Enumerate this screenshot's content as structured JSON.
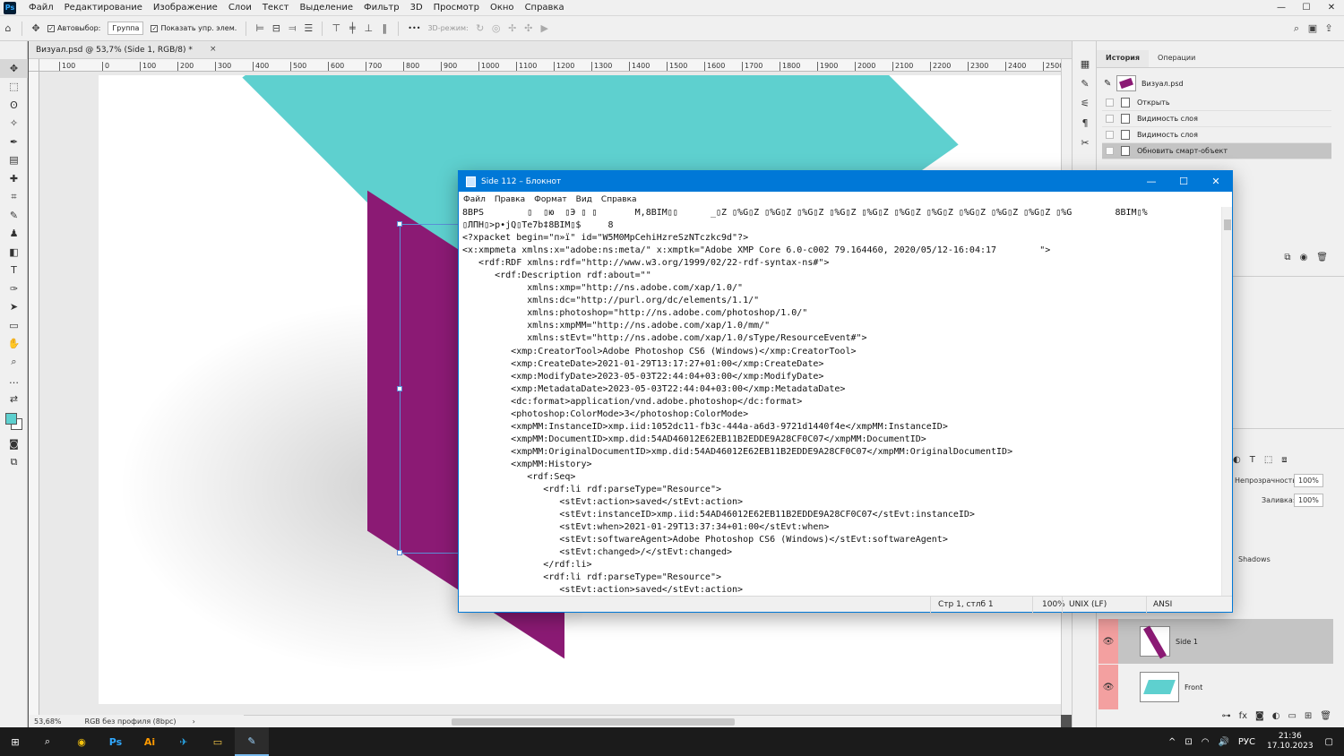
{
  "ps": {
    "logo": "Ps",
    "menu": [
      "Файл",
      "Редактирование",
      "Изображение",
      "Слои",
      "Текст",
      "Выделение",
      "Фильтр",
      "3D",
      "Просмотр",
      "Окно",
      "Справка"
    ],
    "window_buttons": [
      "—",
      "☐",
      "✕"
    ],
    "options": {
      "autoselect_label": "Автовыбор:",
      "group_value": "Группа",
      "show_controls_label": "Показать упр. элем.",
      "mode_3d_label": "3D-режим:",
      "more": "•••"
    },
    "doc_tab": {
      "label": "Визуал.psd @ 53,7% (Side 1, RGB/8) *",
      "close": "×"
    },
    "ruler_ticks": [
      "100",
      "0",
      "100",
      "200",
      "300",
      "400",
      "500",
      "600",
      "700",
      "800",
      "900",
      "1000",
      "1100",
      "1200",
      "1300",
      "1400",
      "1500",
      "1600",
      "1700",
      "1800",
      "1900",
      "2000",
      "2100",
      "2200",
      "2300",
      "2400",
      "2500"
    ],
    "status": {
      "zoom": "53,68%",
      "profile": "RGB без профиля (8bpc)",
      "arrow": "›"
    },
    "history": {
      "tabs": [
        "История",
        "Операции"
      ],
      "snapshot": "Визуал.psd",
      "rows": [
        "Открыть",
        "Видимость слоя",
        "Видимость слоя",
        "Обновить смарт-объект"
      ]
    },
    "layers": {
      "opacity_label": "Непрозрачность:",
      "opacity_value": "100%",
      "fill_label": "Заливка:",
      "fill_value": "100%",
      "shadows_label": "Shadows",
      "rows": [
        {
          "name": "Side 1"
        },
        {
          "name": "Front"
        }
      ]
    }
  },
  "notepad": {
    "title": "Side 112 – Блокнот",
    "menu": [
      "Файл",
      "Правка",
      "Формат",
      "Вид",
      "Справка"
    ],
    "window_buttons": [
      "—",
      "☐",
      "✕"
    ],
    "lines": [
      "8BPS        ▯  ▯ю  ▯Э ▯ ▯       M,8BIM▯▯      _▯Z ▯%G▯Z ▯%G▯Z ▯%G▯Z ▯%G▯Z ▯%G▯Z ▯%G▯Z ▯%G▯Z ▯%G▯Z ▯%G▯Z ▯%G▯Z ▯%G        8BIM▯%",
      "▯ЛПН▯>р•jQ▯Te7b‡8BIM▯$     8",
      "<?xpacket begin=\"п»ї\" id=\"W5M0MpCehiHzreSzNTczkc9d\"?>",
      "<x:xmpmeta xmlns:x=\"adobe:ns:meta/\" x:xmptk=\"Adobe XMP Core 6.0-c002 79.164460, 2020/05/12-16:04:17        \">",
      "   <rdf:RDF xmlns:rdf=\"http://www.w3.org/1999/02/22-rdf-syntax-ns#\">",
      "      <rdf:Description rdf:about=\"\"",
      "            xmlns:xmp=\"http://ns.adobe.com/xap/1.0/\"",
      "            xmlns:dc=\"http://purl.org/dc/elements/1.1/\"",
      "            xmlns:photoshop=\"http://ns.adobe.com/photoshop/1.0/\"",
      "            xmlns:xmpMM=\"http://ns.adobe.com/xap/1.0/mm/\"",
      "            xmlns:stEvt=\"http://ns.adobe.com/xap/1.0/sType/ResourceEvent#\">",
      "         <xmp:CreatorTool>Adobe Photoshop CS6 (Windows)</xmp:CreatorTool>",
      "         <xmp:CreateDate>2021-01-29T13:17:27+01:00</xmp:CreateDate>",
      "         <xmp:ModifyDate>2023-05-03T22:44:04+03:00</xmp:ModifyDate>",
      "         <xmp:MetadataDate>2023-05-03T22:44:04+03:00</xmp:MetadataDate>",
      "         <dc:format>application/vnd.adobe.photoshop</dc:format>",
      "         <photoshop:ColorMode>3</photoshop:ColorMode>",
      "         <xmpMM:InstanceID>xmp.iid:1052dc11-fb3c-444a-a6d3-9721d1440f4e</xmpMM:InstanceID>",
      "         <xmpMM:DocumentID>xmp.did:54AD46012E62EB11B2EDDE9A28CF0C07</xmpMM:DocumentID>",
      "         <xmpMM:OriginalDocumentID>xmp.did:54AD46012E62EB11B2EDDE9A28CF0C07</xmpMM:OriginalDocumentID>",
      "         <xmpMM:History>",
      "            <rdf:Seq>",
      "               <rdf:li rdf:parseType=\"Resource\">",
      "                  <stEvt:action>saved</stEvt:action>",
      "                  <stEvt:instanceID>xmp.iid:54AD46012E62EB11B2EDDE9A28CF0C07</stEvt:instanceID>",
      "                  <stEvt:when>2021-01-29T13:37:34+01:00</stEvt:when>",
      "                  <stEvt:softwareAgent>Adobe Photoshop CS6 (Windows)</stEvt:softwareAgent>",
      "                  <stEvt:changed>/</stEvt:changed>",
      "               </rdf:li>",
      "               <rdf:li rdf:parseType=\"Resource\">",
      "                  <stEvt:action>saved</stEvt:action>"
    ],
    "status": {
      "position": "Стр 1, стлб 1",
      "zoom": "100%",
      "eol": "UNIX (LF)",
      "encoding": "ANSI"
    }
  },
  "taskbar": {
    "apps": [
      "⊞",
      "⌕",
      "◉",
      "Ps",
      "Ai",
      "✈",
      "▭",
      "✎"
    ],
    "language": "РУС",
    "time": "21:36",
    "date": "17.10.2023",
    "tray_icons": [
      "^",
      "⊡",
      "◠",
      "🔊"
    ],
    "notification": "▢"
  },
  "colors": {
    "accent": "#0078d7",
    "teal": "#5ed0cf",
    "purple": "#8b1a74",
    "eye_bg": "#f3a0a0"
  }
}
